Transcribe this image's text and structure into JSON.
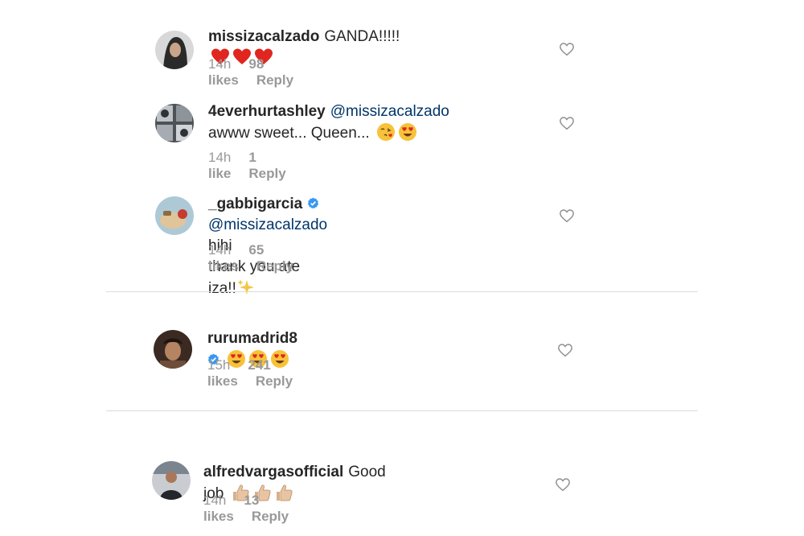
{
  "comments": [
    {
      "username": "missizacalzado",
      "mention": "",
      "text": "GANDA!!!!!",
      "text_line2": "",
      "emojis": [
        "red-heart",
        "red-heart",
        "red-heart"
      ],
      "time": "14h",
      "likes": "98 likes",
      "reply": "Reply",
      "verified": false
    },
    {
      "username": "4everhurtashley",
      "mention": "@missizacalzado",
      "text": "",
      "text_line2": "awww sweet... Queen...",
      "emojis": [
        "face-blowing-kiss",
        "heart-eyes-face"
      ],
      "time": "14h",
      "likes": "1 like",
      "reply": "Reply",
      "verified": false
    },
    {
      "username": "_gabbigarcia",
      "mention": "@missizacalzado",
      "text": "hihi",
      "text_line2": "thank you ate iza!!",
      "emojis": [
        "sparkles"
      ],
      "time": "14h",
      "likes": "65 likes",
      "reply": "Reply",
      "verified": true
    },
    {
      "username": "rurumadrid8",
      "mention": "",
      "text": "",
      "text_line2": "",
      "emojis": [
        "heart-eyes-face",
        "heart-eyes-face",
        "heart-eyes-face"
      ],
      "time": "15h",
      "likes": "241 likes",
      "reply": "Reply",
      "verified": true
    },
    {
      "username": "alfredvargasofficial",
      "mention": "",
      "text": "Good job",
      "text_line2": "",
      "emojis": [
        "thumbs-up",
        "thumbs-up",
        "thumbs-up"
      ],
      "time": "14h",
      "likes": "13 likes",
      "reply": "Reply",
      "verified": false
    }
  ],
  "colors": {
    "username": "#262626",
    "mention": "#003569",
    "meta": "#999999",
    "divider": "#dbdbdb",
    "verified": "#3897f0"
  }
}
